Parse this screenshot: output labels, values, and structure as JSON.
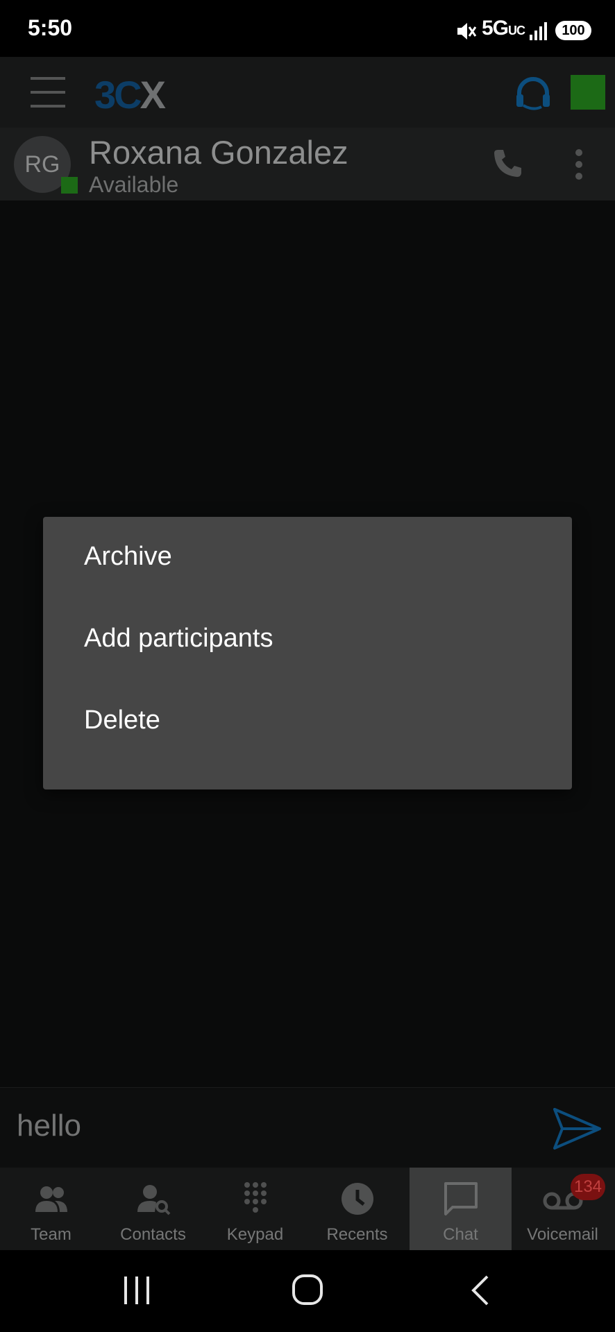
{
  "status_bar": {
    "time": "5:50",
    "network": "5G",
    "network_sub": "UC",
    "battery": "100"
  },
  "app_bar": {
    "logo_3": "3C",
    "logo_x": "X"
  },
  "chat_header": {
    "avatar_initials": "RG",
    "contact_name": "Roxana Gonzalez",
    "contact_status": "Available"
  },
  "context_menu": {
    "items": [
      {
        "label": "Archive"
      },
      {
        "label": "Add participants"
      },
      {
        "label": "Delete"
      }
    ]
  },
  "composer": {
    "value": "hello"
  },
  "bottom_nav": {
    "items": [
      {
        "label": "Team"
      },
      {
        "label": "Contacts"
      },
      {
        "label": "Keypad"
      },
      {
        "label": "Recents"
      },
      {
        "label": "Chat"
      },
      {
        "label": "Voicemail"
      }
    ],
    "voicemail_badge": "134",
    "active": "Chat"
  },
  "colors": {
    "accent": "#0c5f99",
    "presence": "#1c6a16",
    "badge": "#7a1111"
  }
}
